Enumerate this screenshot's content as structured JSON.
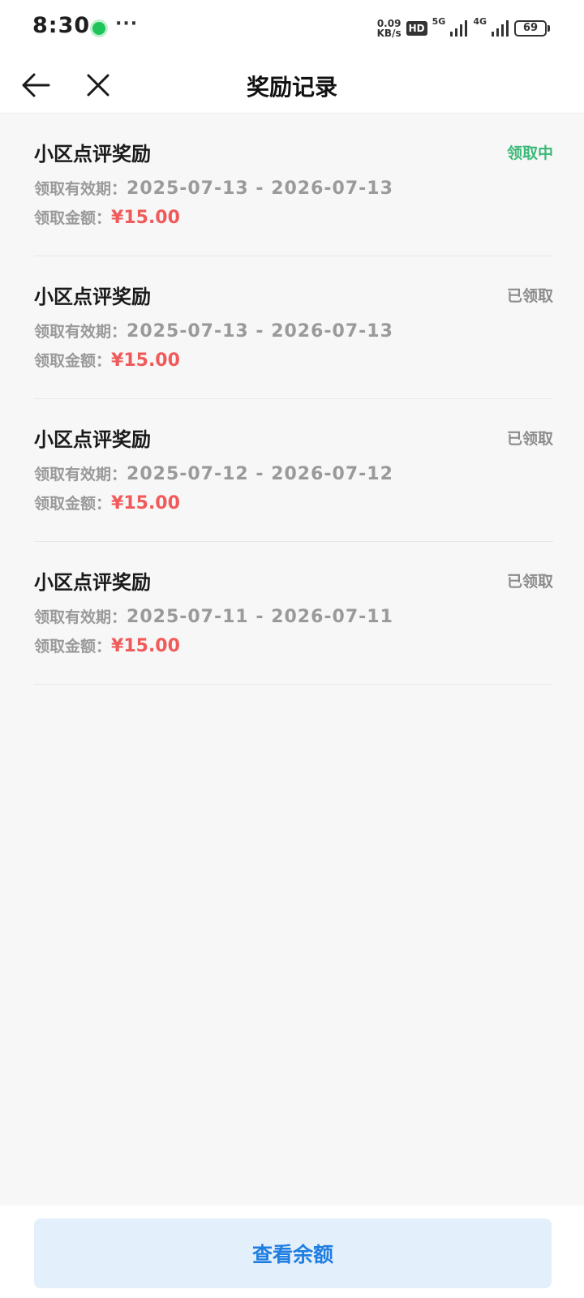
{
  "status_bar": {
    "time": "8:30",
    "more": "···",
    "net_speed_value": "0.09",
    "net_speed_unit": "KB/s",
    "hd_badge": "HD",
    "signal_1": "5G",
    "signal_2": "4G",
    "battery": "69"
  },
  "header": {
    "title": "奖励记录"
  },
  "records": [
    {
      "title": "小区点评奖励",
      "status": "领取中",
      "period_label": "领取有效期：",
      "period": "2025-07-13 - 2026-07-13",
      "amount_label": "领取金额：",
      "amount": "¥15.00"
    },
    {
      "title": "小区点评奖励",
      "status": "已领取",
      "period_label": "领取有效期：",
      "period": "2025-07-13 - 2026-07-13",
      "amount_label": "领取金额：",
      "amount": "¥15.00"
    },
    {
      "title": "小区点评奖励",
      "status": "已领取",
      "period_label": "领取有效期：",
      "period": "2025-07-12 - 2026-07-12",
      "amount_label": "领取金额：",
      "amount": "¥15.00"
    },
    {
      "title": "小区点评奖励",
      "status": "已领取",
      "period_label": "领取有效期：",
      "period": "2025-07-11 - 2026-07-11",
      "amount_label": "领取金额：",
      "amount": "¥15.00"
    }
  ],
  "bottom": {
    "balance_button": "查看余额"
  },
  "colors": {
    "active_status": "#3cb878",
    "amount": "#f05a5a",
    "button_text": "#1f7ee0",
    "button_bg": "#e3effb"
  }
}
